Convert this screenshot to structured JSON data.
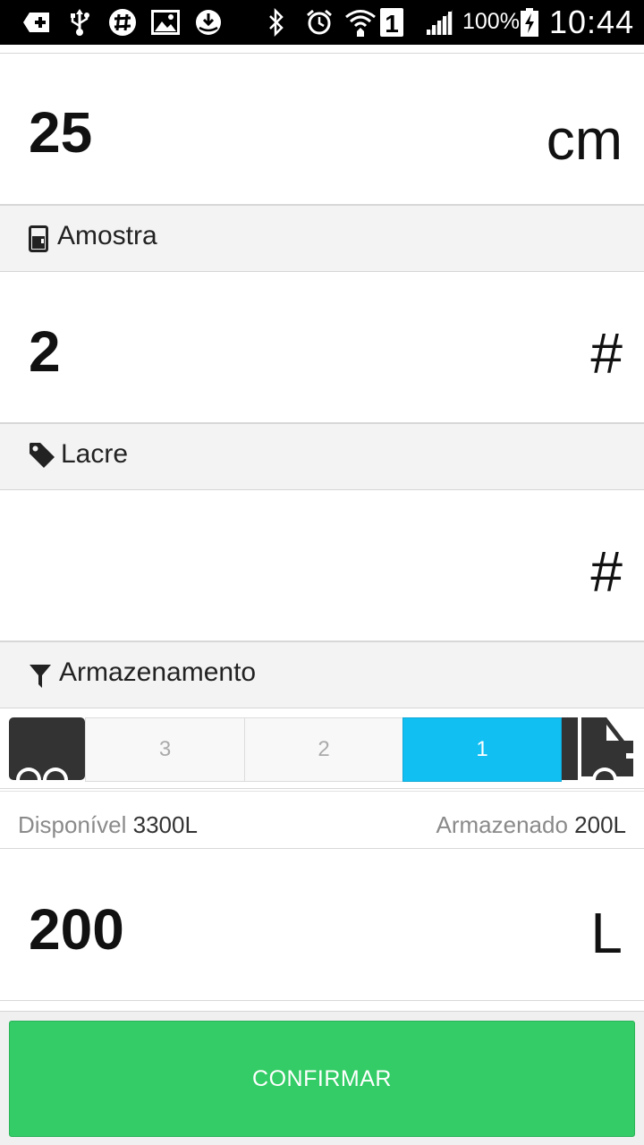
{
  "status_bar": {
    "battery_percent": "100%",
    "time": "10:44",
    "sim_slot": "1",
    "icons": [
      "add-icon",
      "usb-icon",
      "slack-icon",
      "image-icon",
      "download-icon",
      "bluetooth-icon",
      "alarm-icon",
      "wifi-icon",
      "sim-icon",
      "signal-icon",
      "battery-icon"
    ]
  },
  "height_row": {
    "value": "25",
    "unit": "cm"
  },
  "sample_section": {
    "label": "Amostra",
    "icon": "beaker-icon"
  },
  "sample_row": {
    "value": "2",
    "unit": "#"
  },
  "seal_section": {
    "label": "Lacre",
    "icon": "tag-icon"
  },
  "seal_row": {
    "value": "",
    "unit": "#"
  },
  "storage_section": {
    "label": "Armazenamento",
    "icon": "filter-icon"
  },
  "storage": {
    "compartments": [
      "3",
      "2",
      "1"
    ],
    "selected": "1",
    "accent_color": "#12bff2"
  },
  "capacity": {
    "available_label": "Disponível",
    "available_value": "3300L",
    "stored_label": "Armazenado",
    "stored_value": "200L"
  },
  "volume_row": {
    "value": "200",
    "unit": "L"
  },
  "footer": {
    "confirm_label": "CONFIRMAR",
    "confirm_color": "#33cc66"
  }
}
